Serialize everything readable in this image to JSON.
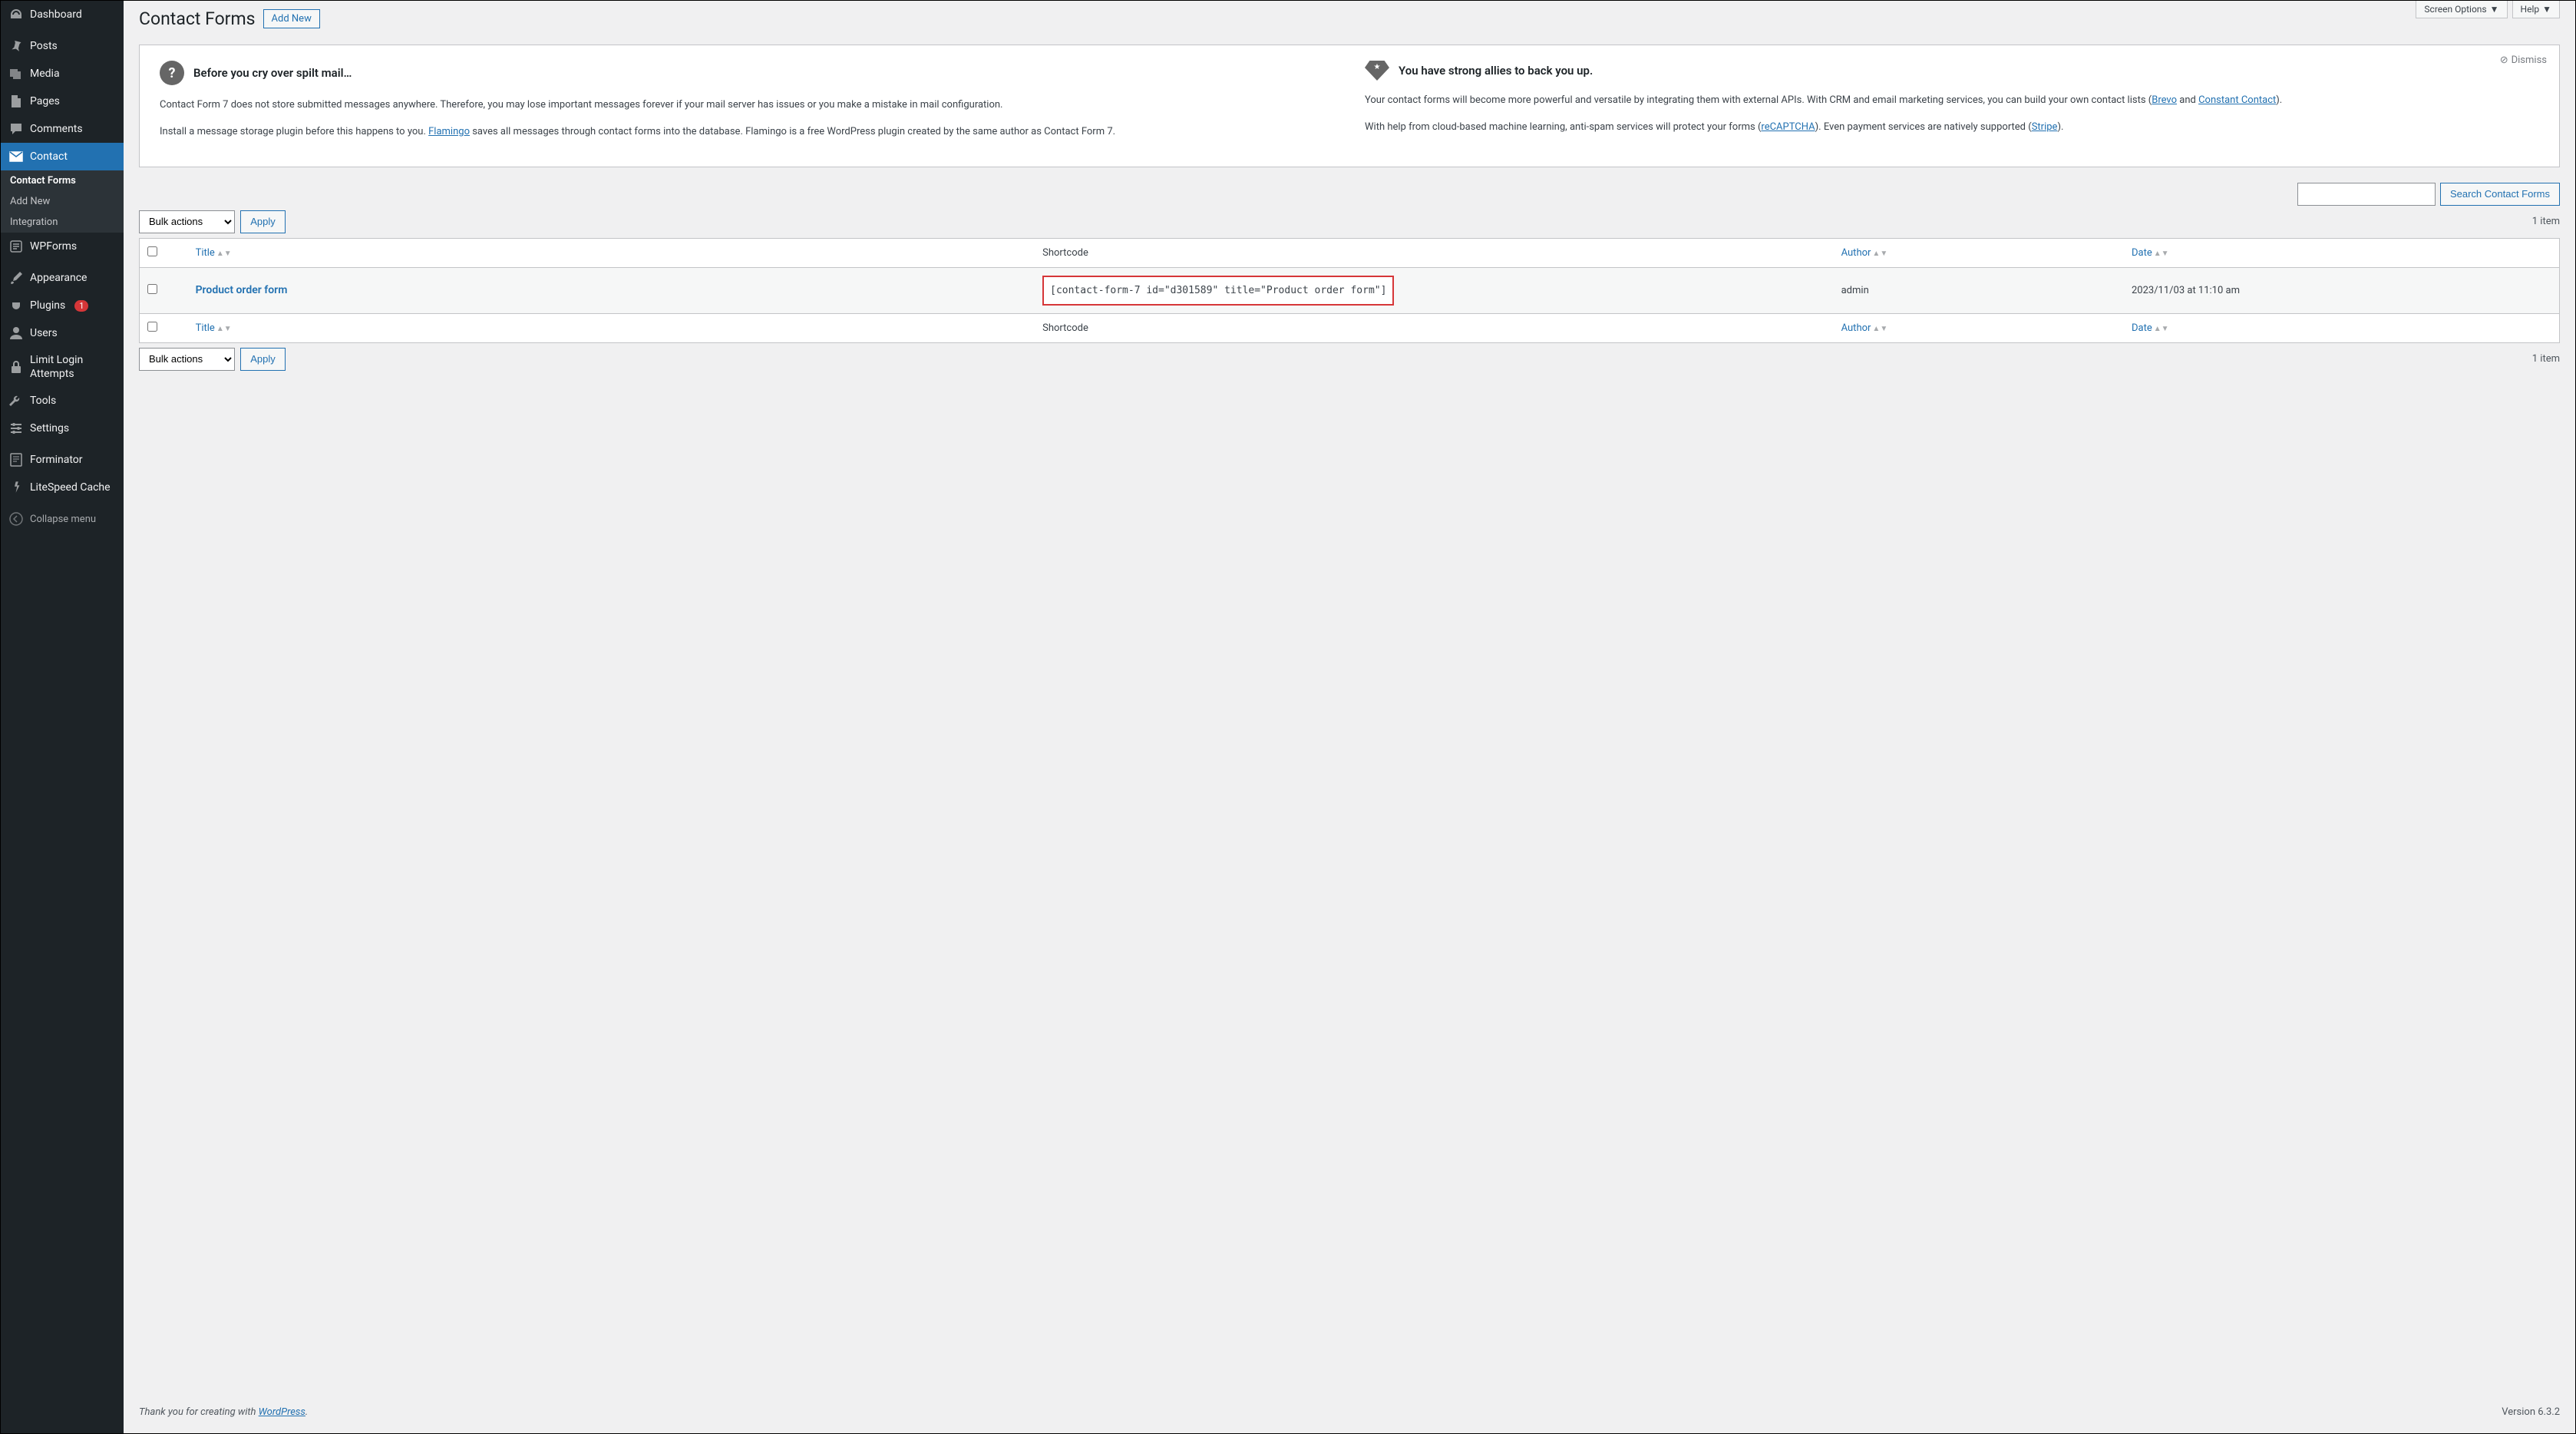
{
  "top": {
    "screen_options": "Screen Options",
    "help": "Help"
  },
  "sidebar": {
    "items": [
      {
        "label": "Dashboard"
      },
      {
        "label": "Posts"
      },
      {
        "label": "Media"
      },
      {
        "label": "Pages"
      },
      {
        "label": "Comments"
      },
      {
        "label": "Contact"
      },
      {
        "label": "WPForms"
      },
      {
        "label": "Appearance"
      },
      {
        "label": "Plugins",
        "badge": "1"
      },
      {
        "label": "Users"
      },
      {
        "label": "Limit Login Attempts"
      },
      {
        "label": "Tools"
      },
      {
        "label": "Settings"
      },
      {
        "label": "Forminator"
      },
      {
        "label": "LiteSpeed Cache"
      }
    ],
    "submenu": [
      {
        "label": "Contact Forms",
        "current": true
      },
      {
        "label": "Add New"
      },
      {
        "label": "Integration"
      }
    ],
    "collapse": "Collapse menu"
  },
  "page": {
    "title": "Contact Forms",
    "add_new": "Add New"
  },
  "notice": {
    "dismiss": "Dismiss",
    "left": {
      "heading": "Before you cry over spilt mail…",
      "p1": "Contact Form 7 does not store submitted messages anywhere. Therefore, you may lose important messages forever if your mail server has issues or you make a mistake in mail configuration.",
      "p2a": "Install a message storage plugin before this happens to you. ",
      "p2_link": "Flamingo",
      "p2b": " saves all messages through contact forms into the database. Flamingo is a free WordPress plugin created by the same author as Contact Form 7."
    },
    "right": {
      "heading": "You have strong allies to back you up.",
      "p1a": "Your contact forms will become more powerful and versatile by integrating them with external APIs. With CRM and email marketing services, you can build your own contact lists (",
      "p1_link1": "Brevo",
      "p1b": " and ",
      "p1_link2": "Constant Contact",
      "p1c": ").",
      "p2a": "With help from cloud-based machine learning, anti-spam services will protect your forms (",
      "p2_link1": "reCAPTCHA",
      "p2b": "). Even payment services are natively supported (",
      "p2_link2": "Stripe",
      "p2c": ")."
    }
  },
  "search": {
    "button": "Search Contact Forms"
  },
  "bulk": {
    "label": "Bulk actions",
    "apply": "Apply"
  },
  "pagination": {
    "count": "1 item"
  },
  "table": {
    "headers": {
      "title": "Title",
      "shortcode": "Shortcode",
      "author": "Author",
      "date": "Date"
    },
    "rows": [
      {
        "title": "Product order form",
        "shortcode": "[contact-form-7 id=\"d301589\" title=\"Product order form\"]",
        "author": "admin",
        "date": "2023/11/03 at 11:10 am"
      }
    ]
  },
  "footer": {
    "thanks_a": "Thank you for creating with ",
    "thanks_link": "WordPress",
    "thanks_b": ".",
    "version": "Version 6.3.2"
  }
}
